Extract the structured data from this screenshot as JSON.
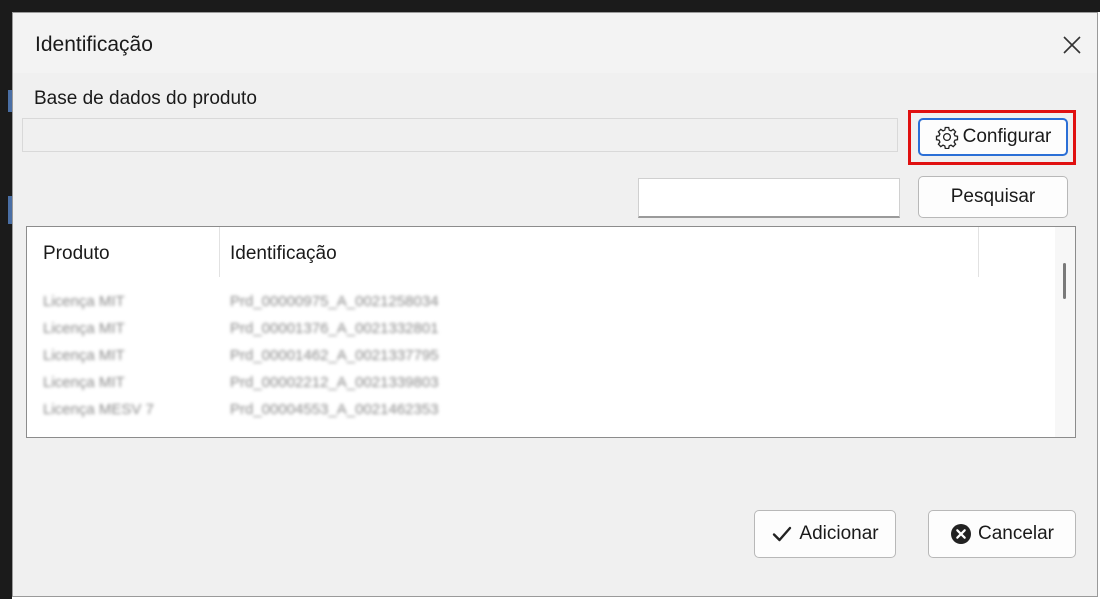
{
  "window": {
    "title": "Identificação",
    "close_icon": "close-icon"
  },
  "database": {
    "label": "Base de dados do produto",
    "value": ""
  },
  "buttons": {
    "configure_label": "Configurar",
    "configure_icon": "gear-icon",
    "search_label": "Pesquisar",
    "add_label": "Adicionar",
    "add_icon": "checkmark-icon",
    "cancel_label": "Cancelar",
    "cancel_icon": "close-circle-icon"
  },
  "search": {
    "value": "",
    "placeholder": ""
  },
  "highlight_color": "#e01010",
  "table": {
    "columns": [
      "Produto",
      "Identificação"
    ],
    "rows": [
      {
        "produto": "Licença MIT",
        "identificacao": "Prd_00000975_A_0021258034"
      },
      {
        "produto": "Licença MIT",
        "identificacao": "Prd_00001376_A_0021332801"
      },
      {
        "produto": "Licença MIT",
        "identificacao": "Prd_00001462_A_0021337795"
      },
      {
        "produto": "Licença MIT",
        "identificacao": "Prd_00002212_A_0021339803"
      },
      {
        "produto": "Licença MESV 7",
        "identificacao": "Prd_00004553_A_0021462353"
      }
    ]
  }
}
